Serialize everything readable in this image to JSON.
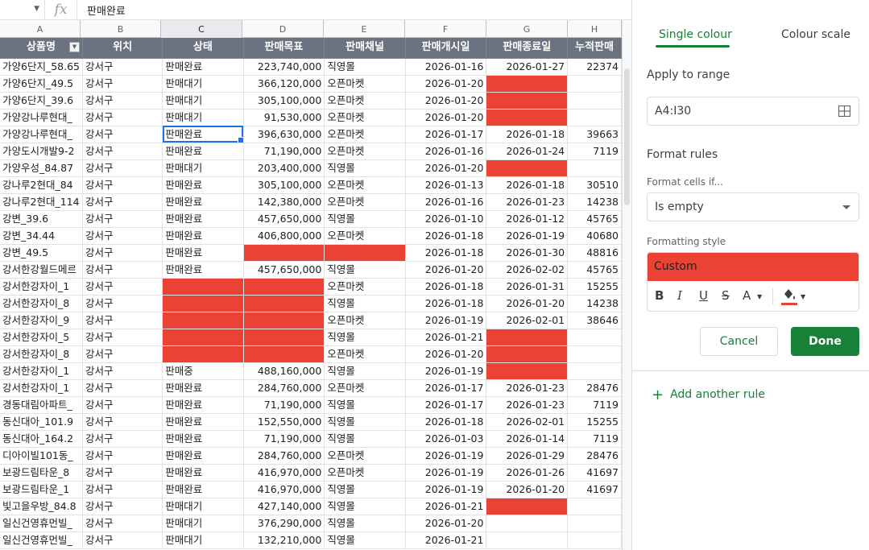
{
  "formula_bar": {
    "fx": "fx",
    "content": "판매완료"
  },
  "columns": [
    "A",
    "B",
    "C",
    "D",
    "E",
    "F",
    "G",
    "H"
  ],
  "headers": [
    "상품명",
    "위치",
    "상태",
    "판매목표",
    "판매채널",
    "판매개시일",
    "판매종료일",
    "누적판매"
  ],
  "rows": [
    [
      "가양6단지_58.65",
      "강서구",
      "판매완료",
      "223,740,000",
      "직영몰",
      "2026-01-16",
      "2026-01-27",
      "22374"
    ],
    [
      "가양6단지_49.5",
      "강서구",
      "판매대기",
      "366,120,000",
      "오픈마켓",
      "2026-01-20",
      "",
      ""
    ],
    [
      "가양6단지_39.6",
      "강서구",
      "판매대기",
      "305,100,000",
      "오픈마켓",
      "2026-01-20",
      "",
      ""
    ],
    [
      "가양강나루현대_",
      "강서구",
      "판매대기",
      "91,530,000",
      "오픈마켓",
      "2026-01-20",
      "",
      ""
    ],
    [
      "가양강나루현대_",
      "강서구",
      "판매완료",
      "396,630,000",
      "오픈마켓",
      "2026-01-17",
      "2026-01-18",
      "39663"
    ],
    [
      "가양도시개발9-2",
      "강서구",
      "판매완료",
      "71,190,000",
      "오픈마켓",
      "2026-01-16",
      "2026-01-24",
      "7119"
    ],
    [
      "가양우성_84.87",
      "강서구",
      "판매대기",
      "203,400,000",
      "직영몰",
      "2026-01-20",
      "",
      ""
    ],
    [
      "강나루2현대_84",
      "강서구",
      "판매완료",
      "305,100,000",
      "오픈마켓",
      "2026-01-13",
      "2026-01-18",
      "30510"
    ],
    [
      "강나루2현대_114",
      "강서구",
      "판매완료",
      "142,380,000",
      "오픈마켓",
      "2026-01-16",
      "2026-01-23",
      "14238"
    ],
    [
      "강변_39.6",
      "강서구",
      "판매완료",
      "457,650,000",
      "직영몰",
      "2026-01-10",
      "2026-01-12",
      "45765"
    ],
    [
      "강변_34.44",
      "강서구",
      "판매완료",
      "406,800,000",
      "오픈마켓",
      "2026-01-18",
      "2026-01-19",
      "40680"
    ],
    [
      "강변_49.5",
      "강서구",
      "판매완료",
      "",
      "",
      "2026-01-18",
      "2026-01-30",
      "48816"
    ],
    [
      "강서한강월드메르",
      "강서구",
      "판매완료",
      "457,650,000",
      "직영몰",
      "2026-01-20",
      "2026-02-02",
      "45765"
    ],
    [
      "강서한강자이_1",
      "강서구",
      "",
      "",
      "오픈마켓",
      "2026-01-18",
      "2026-01-31",
      "15255"
    ],
    [
      "강서한강자이_8",
      "강서구",
      "",
      "",
      "직영몰",
      "2026-01-18",
      "2026-01-20",
      "14238"
    ],
    [
      "강서한강자이_9",
      "강서구",
      "",
      "",
      "오픈마켓",
      "2026-01-19",
      "2026-02-01",
      "38646"
    ],
    [
      "강서한강자이_5",
      "강서구",
      "",
      "",
      "직영몰",
      "2026-01-21",
      "",
      ""
    ],
    [
      "강서한강자이_8",
      "강서구",
      "",
      "",
      "오픈마켓",
      "2026-01-20",
      "",
      ""
    ],
    [
      "강서한강자이_1",
      "강서구",
      "판매중",
      "488,160,000",
      "직영몰",
      "2026-01-19",
      "",
      ""
    ],
    [
      "강서한강자이_1",
      "강서구",
      "판매완료",
      "284,760,000",
      "오픈마켓",
      "2026-01-17",
      "2026-01-23",
      "28476"
    ],
    [
      "경동대림아파트_",
      "강서구",
      "판매완료",
      "71,190,000",
      "직영몰",
      "2026-01-17",
      "2026-01-23",
      "7119"
    ],
    [
      "동신대아_101.9",
      "강서구",
      "판매완료",
      "152,550,000",
      "직영몰",
      "2026-01-18",
      "2026-02-01",
      "15255"
    ],
    [
      "동신대아_164.2",
      "강서구",
      "판매완료",
      "71,190,000",
      "직영몰",
      "2026-01-03",
      "2026-01-14",
      "7119"
    ],
    [
      "디아이빌101동_",
      "강서구",
      "판매완료",
      "284,760,000",
      "오픈마켓",
      "2026-01-19",
      "2026-01-29",
      "28476"
    ],
    [
      "보광드림타운_8",
      "강서구",
      "판매완료",
      "416,970,000",
      "오픈마켓",
      "2026-01-19",
      "2026-01-26",
      "41697"
    ],
    [
      "보광드림타운_1",
      "강서구",
      "판매완료",
      "416,970,000",
      "직영몰",
      "2026-01-19",
      "2026-01-20",
      "41697"
    ],
    [
      "빛고을우방_84.8",
      "강서구",
      "판매대기",
      "427,140,000",
      "직영몰",
      "2026-01-21",
      "",
      ""
    ],
    [
      "일신건영휴먼빌_",
      "강서구",
      "판매대기",
      "376,290,000",
      "직영몰",
      "2026-01-20",
      "",
      ""
    ],
    [
      "일신건영휴먼빌_",
      "강서구",
      "판매대기",
      "132,210,000",
      "직영몰",
      "2026-01-21",
      "",
      ""
    ]
  ],
  "red_cells": [
    [
      1,
      6
    ],
    [
      2,
      6
    ],
    [
      3,
      6
    ],
    [
      6,
      6
    ],
    [
      11,
      3
    ],
    [
      11,
      4
    ],
    [
      13,
      2
    ],
    [
      13,
      3
    ],
    [
      14,
      2
    ],
    [
      14,
      3
    ],
    [
      15,
      2
    ],
    [
      15,
      3
    ],
    [
      16,
      2
    ],
    [
      16,
      3
    ],
    [
      17,
      2
    ],
    [
      17,
      3
    ],
    [
      16,
      6
    ],
    [
      17,
      6
    ],
    [
      18,
      6
    ],
    [
      26,
      6
    ]
  ],
  "selected_cell": [
    4,
    2
  ],
  "highlight_color": "#ea4335",
  "panel": {
    "tab_single": "Single colour",
    "tab_scale": "Colour scale",
    "apply_to_range_label": "Apply to range",
    "range_value": "A4:I30",
    "format_rules_label": "Format rules",
    "format_cells_if_label": "Format cells if...",
    "condition_value": "Is empty",
    "formatting_style_label": "Formatting style",
    "style_preview_label": "Custom",
    "text_color_glyph": "A",
    "cancel_label": "Cancel",
    "done_label": "Done",
    "add_rule_plus": "+",
    "add_rule_label": "Add another rule",
    "accent_color": "#188038"
  }
}
